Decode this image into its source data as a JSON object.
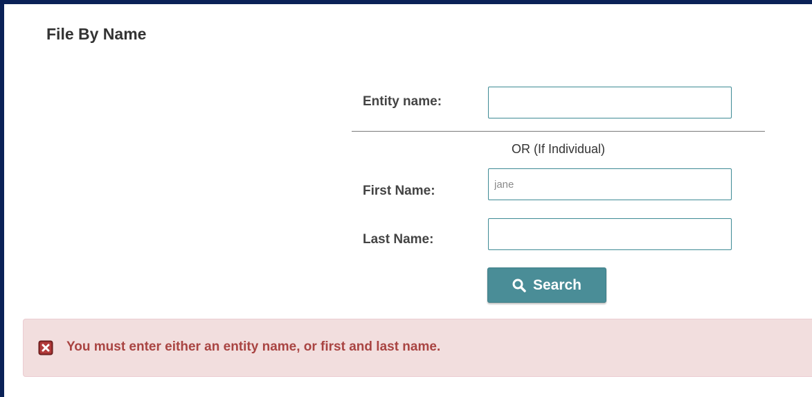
{
  "page": {
    "title": "File By Name"
  },
  "form": {
    "entity_name": {
      "label": "Entity name:",
      "value": ""
    },
    "separator_text": "OR (If Individual)",
    "first_name": {
      "label": "First Name:",
      "value": "",
      "placeholder": "jane"
    },
    "last_name": {
      "label": "Last Name:",
      "value": ""
    },
    "search_button": {
      "label": "Search",
      "icon": "search-icon"
    }
  },
  "error": {
    "icon": "close-icon",
    "message": "You must enter either an entity name, or first and last name."
  },
  "colors": {
    "frame_border": "#0a2157",
    "button_bg": "#4a8d97",
    "input_border": "#3d8a94",
    "error_bg": "#f2dede",
    "error_text": "#a94442"
  }
}
